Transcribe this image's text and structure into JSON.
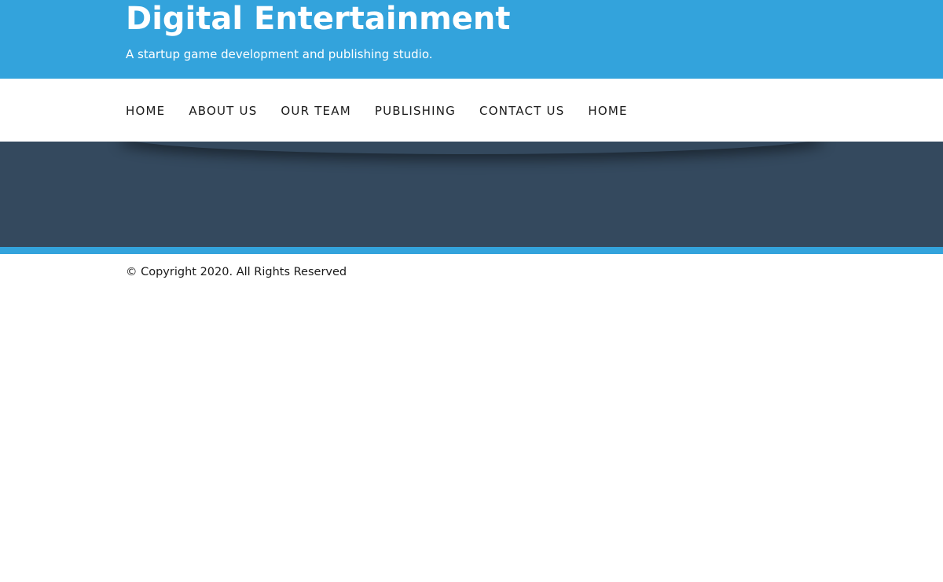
{
  "header": {
    "title": "Digital Entertainment",
    "tagline": "A startup game development and publishing studio."
  },
  "nav": {
    "items": [
      {
        "label": "HOME"
      },
      {
        "label": "ABOUT US"
      },
      {
        "label": "OUR TEAM"
      },
      {
        "label": "PUBLISHING"
      },
      {
        "label": "CONTACT US"
      },
      {
        "label": "HOME"
      }
    ]
  },
  "footer": {
    "copyright": "© Copyright 2020. All Rights Reserved"
  },
  "colors": {
    "header_bg": "#33a3dc",
    "hero_bg": "#34495e",
    "accent": "#33a3dc",
    "text": "#1a1a1a"
  }
}
